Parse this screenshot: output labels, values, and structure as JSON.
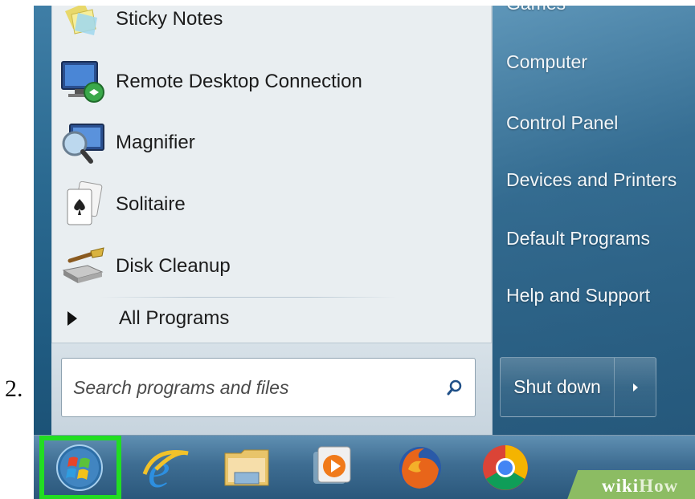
{
  "step": {
    "number": "2."
  },
  "start_menu": {
    "programs": [
      {
        "label": "Sticky Notes",
        "icon": "sticky-notes-icon"
      },
      {
        "label": "Remote Desktop Connection",
        "icon": "remote-desktop-icon"
      },
      {
        "label": "Magnifier",
        "icon": "magnifier-icon"
      },
      {
        "label": "Solitaire",
        "icon": "solitaire-icon"
      },
      {
        "label": "Disk Cleanup",
        "icon": "disk-cleanup-icon"
      }
    ],
    "all_programs": "All Programs",
    "search": {
      "placeholder": "Search programs and files"
    },
    "right_pane": [
      {
        "label": "Games"
      },
      {
        "label": "Computer"
      },
      {
        "label": "Control Panel"
      },
      {
        "label": "Devices and Printers"
      },
      {
        "label": "Default Programs"
      },
      {
        "label": "Help and Support"
      }
    ],
    "shutdown_label": "Shut down"
  },
  "taskbar": {
    "icons": [
      "start-orb-icon",
      "internet-explorer-icon",
      "file-explorer-icon",
      "media-player-icon",
      "firefox-icon",
      "chrome-icon"
    ],
    "highlight_color": "#22dd22"
  },
  "watermark": {
    "wiki": "wiki",
    "how": "How"
  }
}
